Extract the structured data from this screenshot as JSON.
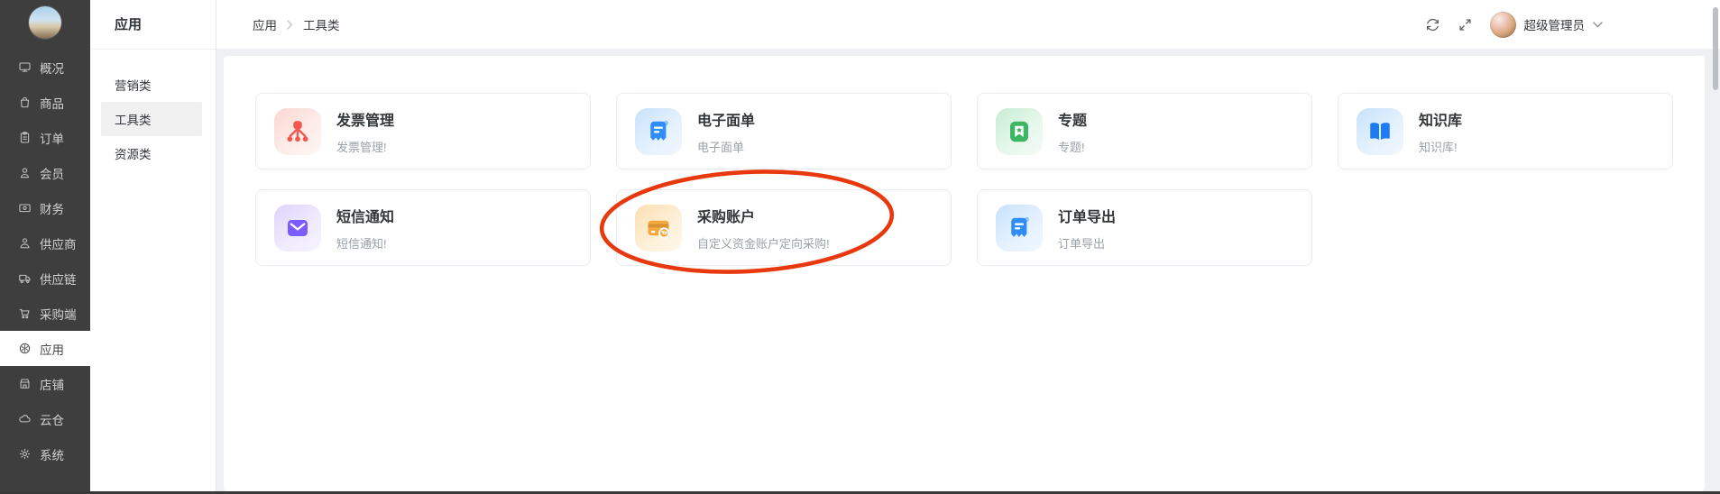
{
  "colors": {
    "sidebar_bg": "#3e3e3e",
    "page_bg": "#eef0f4",
    "annotation_red": "#e8380d"
  },
  "sidebar": {
    "items": [
      {
        "id": "overview",
        "label": "概况",
        "icon": "monitor",
        "active": false
      },
      {
        "id": "goods",
        "label": "商品",
        "icon": "bag",
        "active": false
      },
      {
        "id": "orders",
        "label": "订单",
        "icon": "clipboard",
        "active": false
      },
      {
        "id": "members",
        "label": "会员",
        "icon": "member",
        "active": false
      },
      {
        "id": "finance",
        "label": "财务",
        "icon": "finance",
        "active": false
      },
      {
        "id": "supplier",
        "label": "供应商",
        "icon": "supplier",
        "active": false
      },
      {
        "id": "supply-chain",
        "label": "供应链",
        "icon": "truck",
        "active": false
      },
      {
        "id": "procurement",
        "label": "采购端",
        "icon": "cart",
        "active": false
      },
      {
        "id": "apps",
        "label": "应用",
        "icon": "wheel",
        "active": true
      },
      {
        "id": "shop",
        "label": "店铺",
        "icon": "shop",
        "active": false
      },
      {
        "id": "cloud-warehouse",
        "label": "云仓",
        "icon": "cloud",
        "active": false
      },
      {
        "id": "system",
        "label": "系统",
        "icon": "gear",
        "active": false
      }
    ]
  },
  "submenu": {
    "title": "应用",
    "items": [
      {
        "id": "marketing",
        "label": "营销类",
        "active": false
      },
      {
        "id": "tools",
        "label": "工具类",
        "active": true
      },
      {
        "id": "resources",
        "label": "资源类",
        "active": false
      }
    ]
  },
  "header": {
    "breadcrumb": [
      "应用",
      "工具类"
    ],
    "icons": [
      "refresh-icon",
      "fullscreen-icon",
      "caret-down-icon"
    ],
    "user_name": "超级管理员"
  },
  "apps": [
    {
      "id": "invoice-management",
      "title": "发票管理",
      "desc": "发票管理!",
      "icon": "invoice",
      "theme": "red",
      "color": "#f5584e",
      "circled": false
    },
    {
      "id": "e-waybill",
      "title": "电子面单",
      "desc": "电子面单",
      "icon": "receipt",
      "theme": "blue",
      "color": "#2f8df5",
      "circled": false
    },
    {
      "id": "topics",
      "title": "专题",
      "desc": "专题!",
      "icon": "topic",
      "theme": "green",
      "color": "#3cb662",
      "circled": false
    },
    {
      "id": "knowledge-base",
      "title": "知识库",
      "desc": "知识库!",
      "icon": "book",
      "theme": "blue",
      "color": "#1f7bf4",
      "circled": false
    },
    {
      "id": "sms-notification",
      "title": "短信通知",
      "desc": "短信通知!",
      "icon": "mail",
      "theme": "purple",
      "color": "#7c5cfc",
      "circled": false
    },
    {
      "id": "purchase-account",
      "title": "采购账户",
      "desc": "自定义资金账户定向采购!",
      "icon": "card",
      "theme": "orange",
      "color": "#f6a83c",
      "circled": true
    },
    {
      "id": "order-export",
      "title": "订单导出",
      "desc": "订单导出",
      "icon": "receipt",
      "theme": "blue",
      "color": "#2f8df5",
      "circled": false
    }
  ]
}
